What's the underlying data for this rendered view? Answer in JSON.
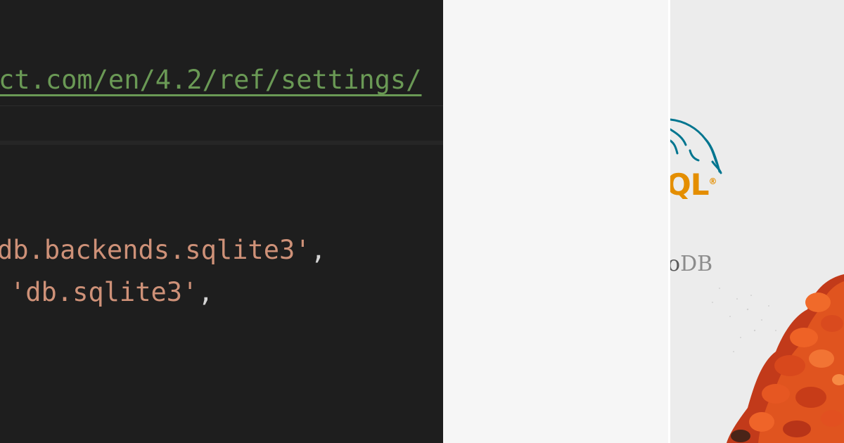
{
  "editor": {
    "url_fragment": "ct.com/en/4.2/ref/settings/",
    "line1": {
      "string": "db.backends.sqlite3'",
      "punct": ","
    },
    "line2": {
      "string": "'db.sqlite3'",
      "punct": ","
    }
  },
  "logos": {
    "mysql": {
      "text": "QL",
      "reg": "®"
    },
    "mongodb": {
      "prefix": "o",
      "text": "DB"
    }
  },
  "colors": {
    "editor_bg": "#1e1e1e",
    "comment_green": "#6a9955",
    "string_orange": "#ce9178",
    "mysql_orange": "#e48e00",
    "mysql_blue": "#00758f"
  }
}
